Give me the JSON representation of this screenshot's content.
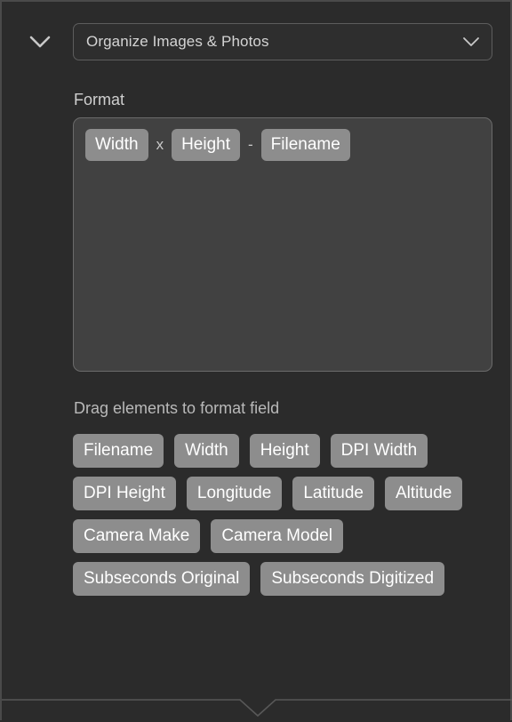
{
  "panel": {
    "collapse_icon": "chevron-down-icon"
  },
  "header": {
    "section_select": {
      "value": "Organize Images & Photos",
      "chevron_icon": "chevron-down-icon"
    }
  },
  "format_section": {
    "label": "Format",
    "tokens": [
      {
        "type": "pill",
        "text": "Width"
      },
      {
        "type": "separator",
        "text": "x"
      },
      {
        "type": "pill",
        "text": "Height"
      },
      {
        "type": "separator",
        "text": "-"
      },
      {
        "type": "pill",
        "text": "Filename"
      }
    ]
  },
  "elements_section": {
    "hint": "Drag elements to format field",
    "pills": [
      "Filename",
      "Width",
      "Height",
      "DPI Width",
      "DPI Height",
      "Longitude",
      "Latitude",
      "Altitude",
      "Camera Make",
      "Camera Model",
      "Subseconds Original",
      "Subseconds Digitized"
    ]
  },
  "footer": {
    "notch_icon": "chevron-down-notch-icon"
  },
  "colors": {
    "panel_background": "#2b2b2b",
    "field_background": "#414141",
    "pill_background": "#8d8d8d",
    "pill_text": "#ffffff",
    "border": "#5d5d5d",
    "label_text": "#cfcfcf",
    "divider": "#585858"
  }
}
